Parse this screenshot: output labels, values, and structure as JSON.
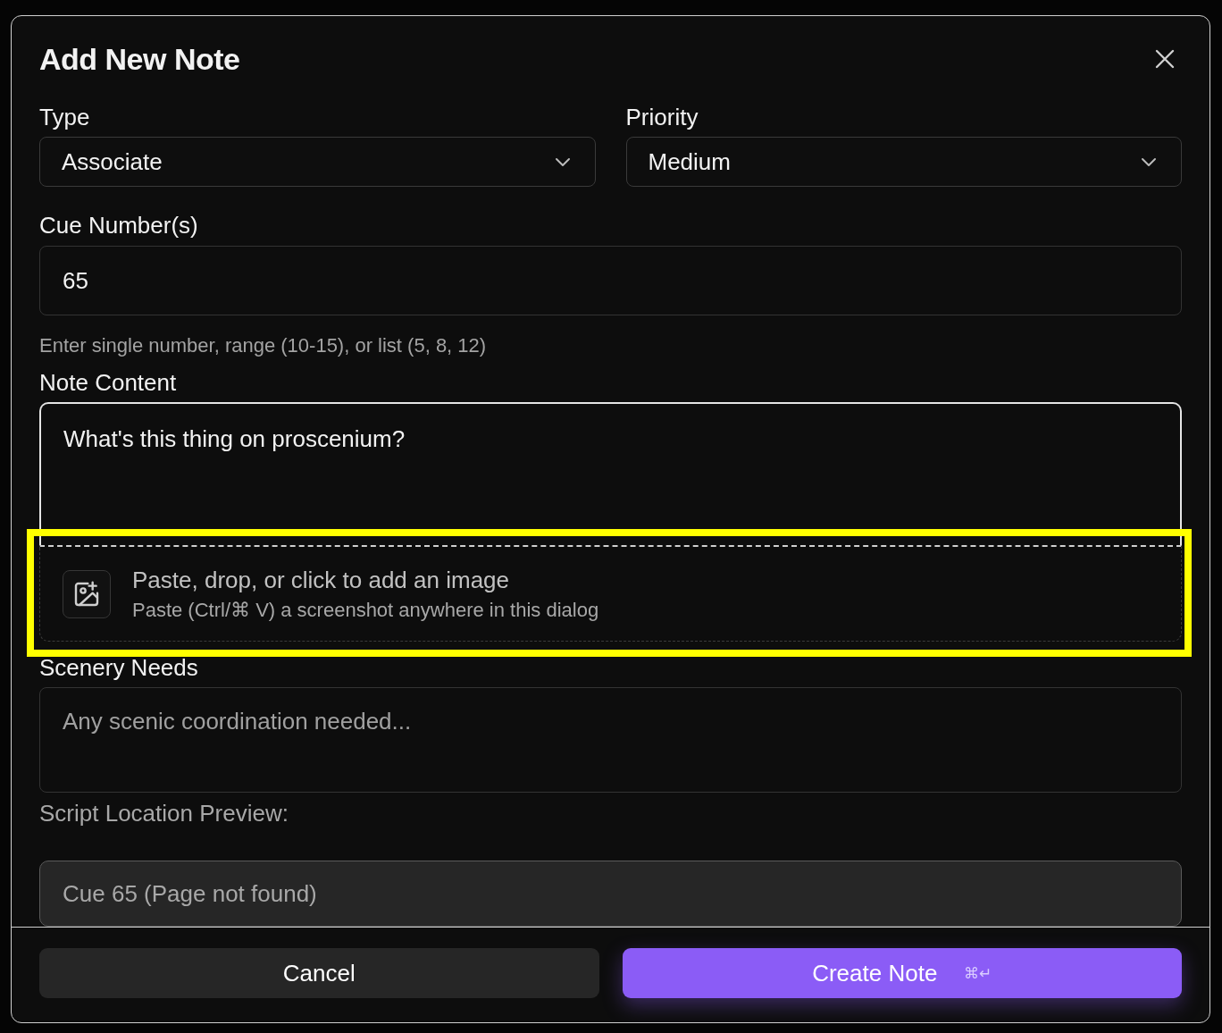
{
  "dialog": {
    "title": "Add New Note"
  },
  "type_field": {
    "label": "Type",
    "value": "Associate"
  },
  "priority_field": {
    "label": "Priority",
    "value": "Medium"
  },
  "cue_field": {
    "label": "Cue Number(s)",
    "value": "65",
    "hint": "Enter single number, range (10-15), or list (5, 8, 12)"
  },
  "note_content": {
    "label": "Note Content",
    "value": "What's this thing on proscenium?",
    "focused": true
  },
  "image_drop": {
    "title": "Paste, drop, or click to add an image",
    "subtitle": "Paste (Ctrl/⌘ V) a screenshot anywhere in this dialog",
    "highlighted": true
  },
  "scenery_needs": {
    "label": "Scenery Needs",
    "placeholder": "Any scenic coordination needed..."
  },
  "script_location": {
    "label": "Script Location Preview:",
    "value": "Cue 65 (Page not found)"
  },
  "buttons": [
    {
      "kind": "secondary",
      "label": "Cancel"
    },
    {
      "kind": "primary",
      "label": "Create Note",
      "shortcut": "⌘↵"
    }
  ]
}
